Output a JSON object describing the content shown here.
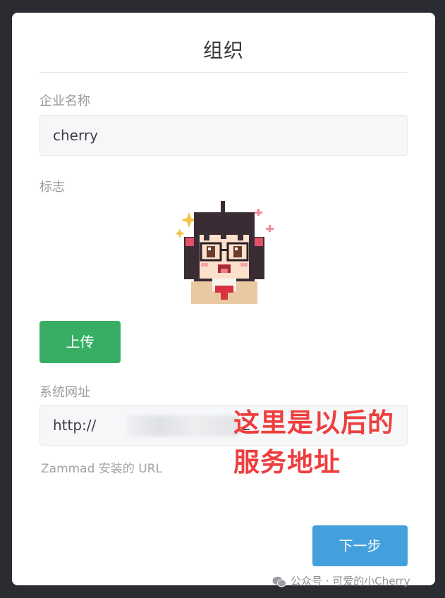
{
  "page": {
    "title": "组织",
    "company_label": "企业名称",
    "company_value": "cherry",
    "logo_label": "标志",
    "upload_label": "上传",
    "url_label": "系统网址",
    "url_prefix": "http://",
    "url_suffix": "2",
    "url_hint": "Zammad 安装的 URL",
    "next_label": "下一步"
  },
  "annotation": {
    "line1": "这里是以后的",
    "line2": "服务地址"
  },
  "watermark": {
    "text": "公众号 · 可爱的小Cherry"
  },
  "colors": {
    "upload_button": "#38ae65",
    "next_button": "#44a0dd",
    "annotation": "#ee3e3e"
  }
}
